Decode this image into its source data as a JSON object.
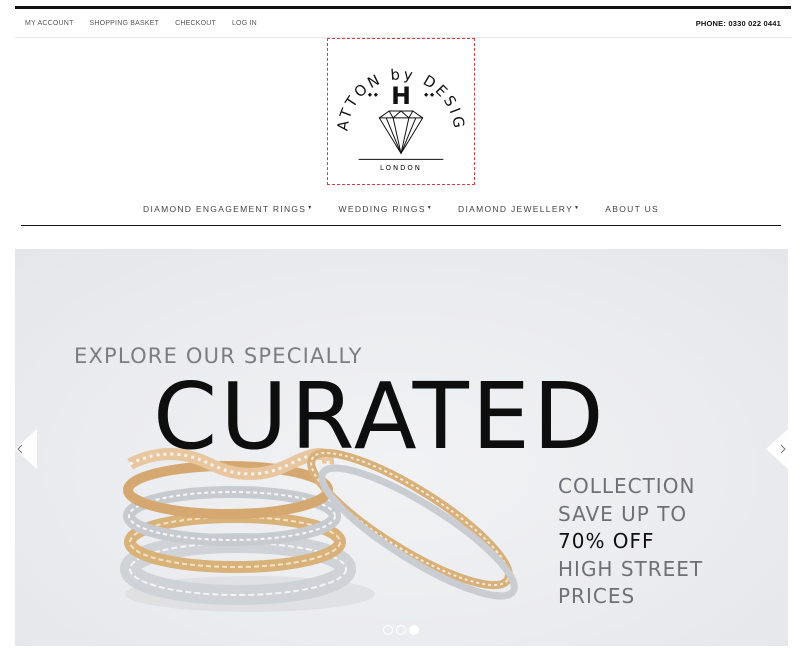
{
  "topbar": {
    "links": [
      "MY ACCOUNT",
      "SHOPPING BASKET",
      "CHECKOUT",
      "LOG IN"
    ],
    "phone": "PHONE: 0330 022 0441"
  },
  "logo": {
    "arc_text": "HATTON by DESIGN",
    "letter": "H",
    "location": "LONDON"
  },
  "main_nav": [
    {
      "label": "DIAMOND ENGAGEMENT RINGS",
      "has_dropdown": true
    },
    {
      "label": "WEDDING RINGS",
      "has_dropdown": true
    },
    {
      "label": "DIAMOND JEWELLERY",
      "has_dropdown": true
    },
    {
      "label": "ABOUT US",
      "has_dropdown": false
    }
  ],
  "hero": {
    "line1": "EXPLORE OUR SPECIALLY",
    "headline": "CURATED",
    "right_lines": [
      "COLLECTION",
      "SAVE UP TO",
      "70% OFF",
      "HIGH STREET",
      "PRICES"
    ],
    "highlight_index": 2,
    "slides": 3,
    "active_slide": 3
  },
  "icons": {
    "prev": "chevron-left-icon",
    "next": "chevron-right-icon",
    "caret": "caret-down-icon",
    "diamond": "diamond-icon"
  },
  "colors": {
    "hero_bg": "#ebecef",
    "headline": "#0e0e0e",
    "subtext": "#6e7075",
    "logo_border": "#d04040"
  }
}
